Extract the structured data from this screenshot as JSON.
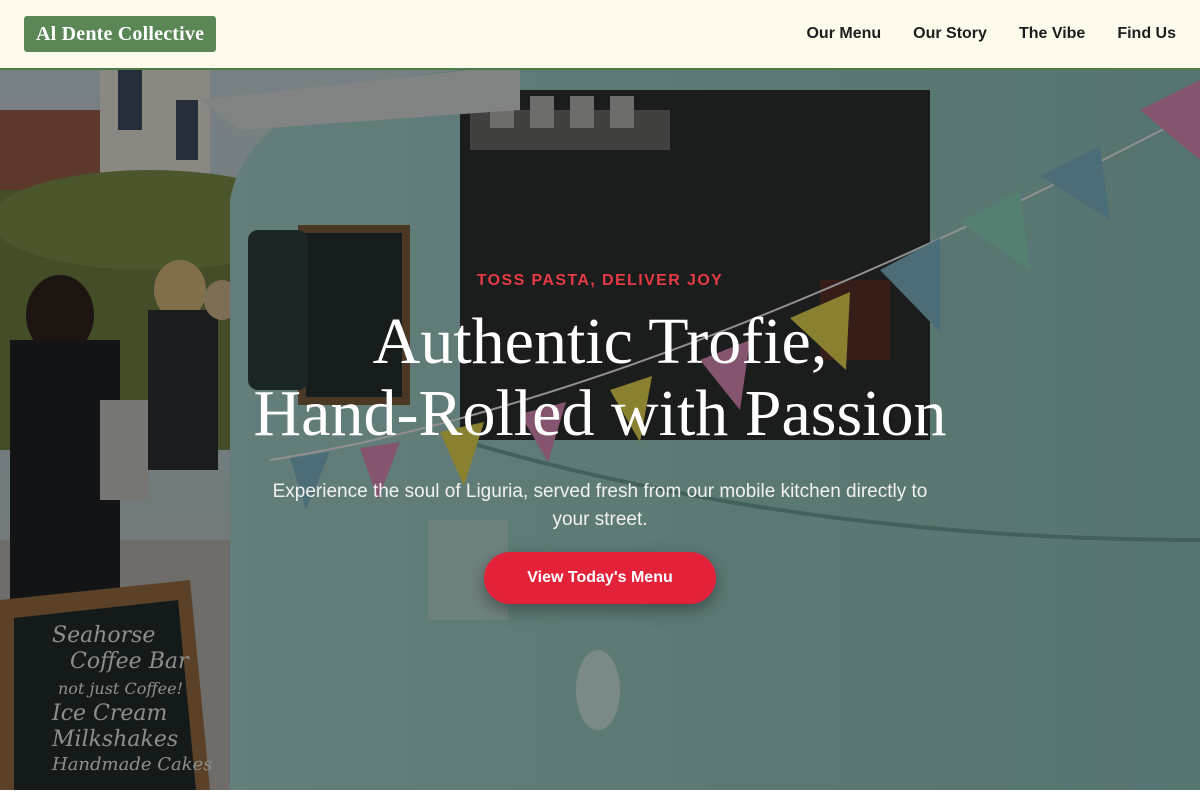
{
  "brand": {
    "name": "Al Dente Collective"
  },
  "nav": {
    "items": [
      {
        "label": "Our Menu"
      },
      {
        "label": "Our Story"
      },
      {
        "label": "The Vibe"
      },
      {
        "label": "Find Us"
      }
    ]
  },
  "hero": {
    "eyebrow": "TOSS PASTA, DELIVER JOY",
    "headline_line1": "Authentic Trofie,",
    "headline_line2": "Hand-Rolled with Passion",
    "subtext": "Experience the soul of Liguria, served fresh from our mobile kitchen directly to your street.",
    "cta_label": "View Today's Menu"
  },
  "photo": {
    "menu_board_lines": [
      "Seahorse",
      "Coffee Bar",
      "not just Coffee!",
      "Ice Cream",
      "Milkshakes",
      "Handmade Cakes"
    ]
  },
  "colors": {
    "header_bg": "#fefaec",
    "logo_bg": "#5b8655",
    "accent_red": "#e3223a",
    "eyebrow_red": "#e63a44",
    "van_teal": "#8fc3bd"
  }
}
